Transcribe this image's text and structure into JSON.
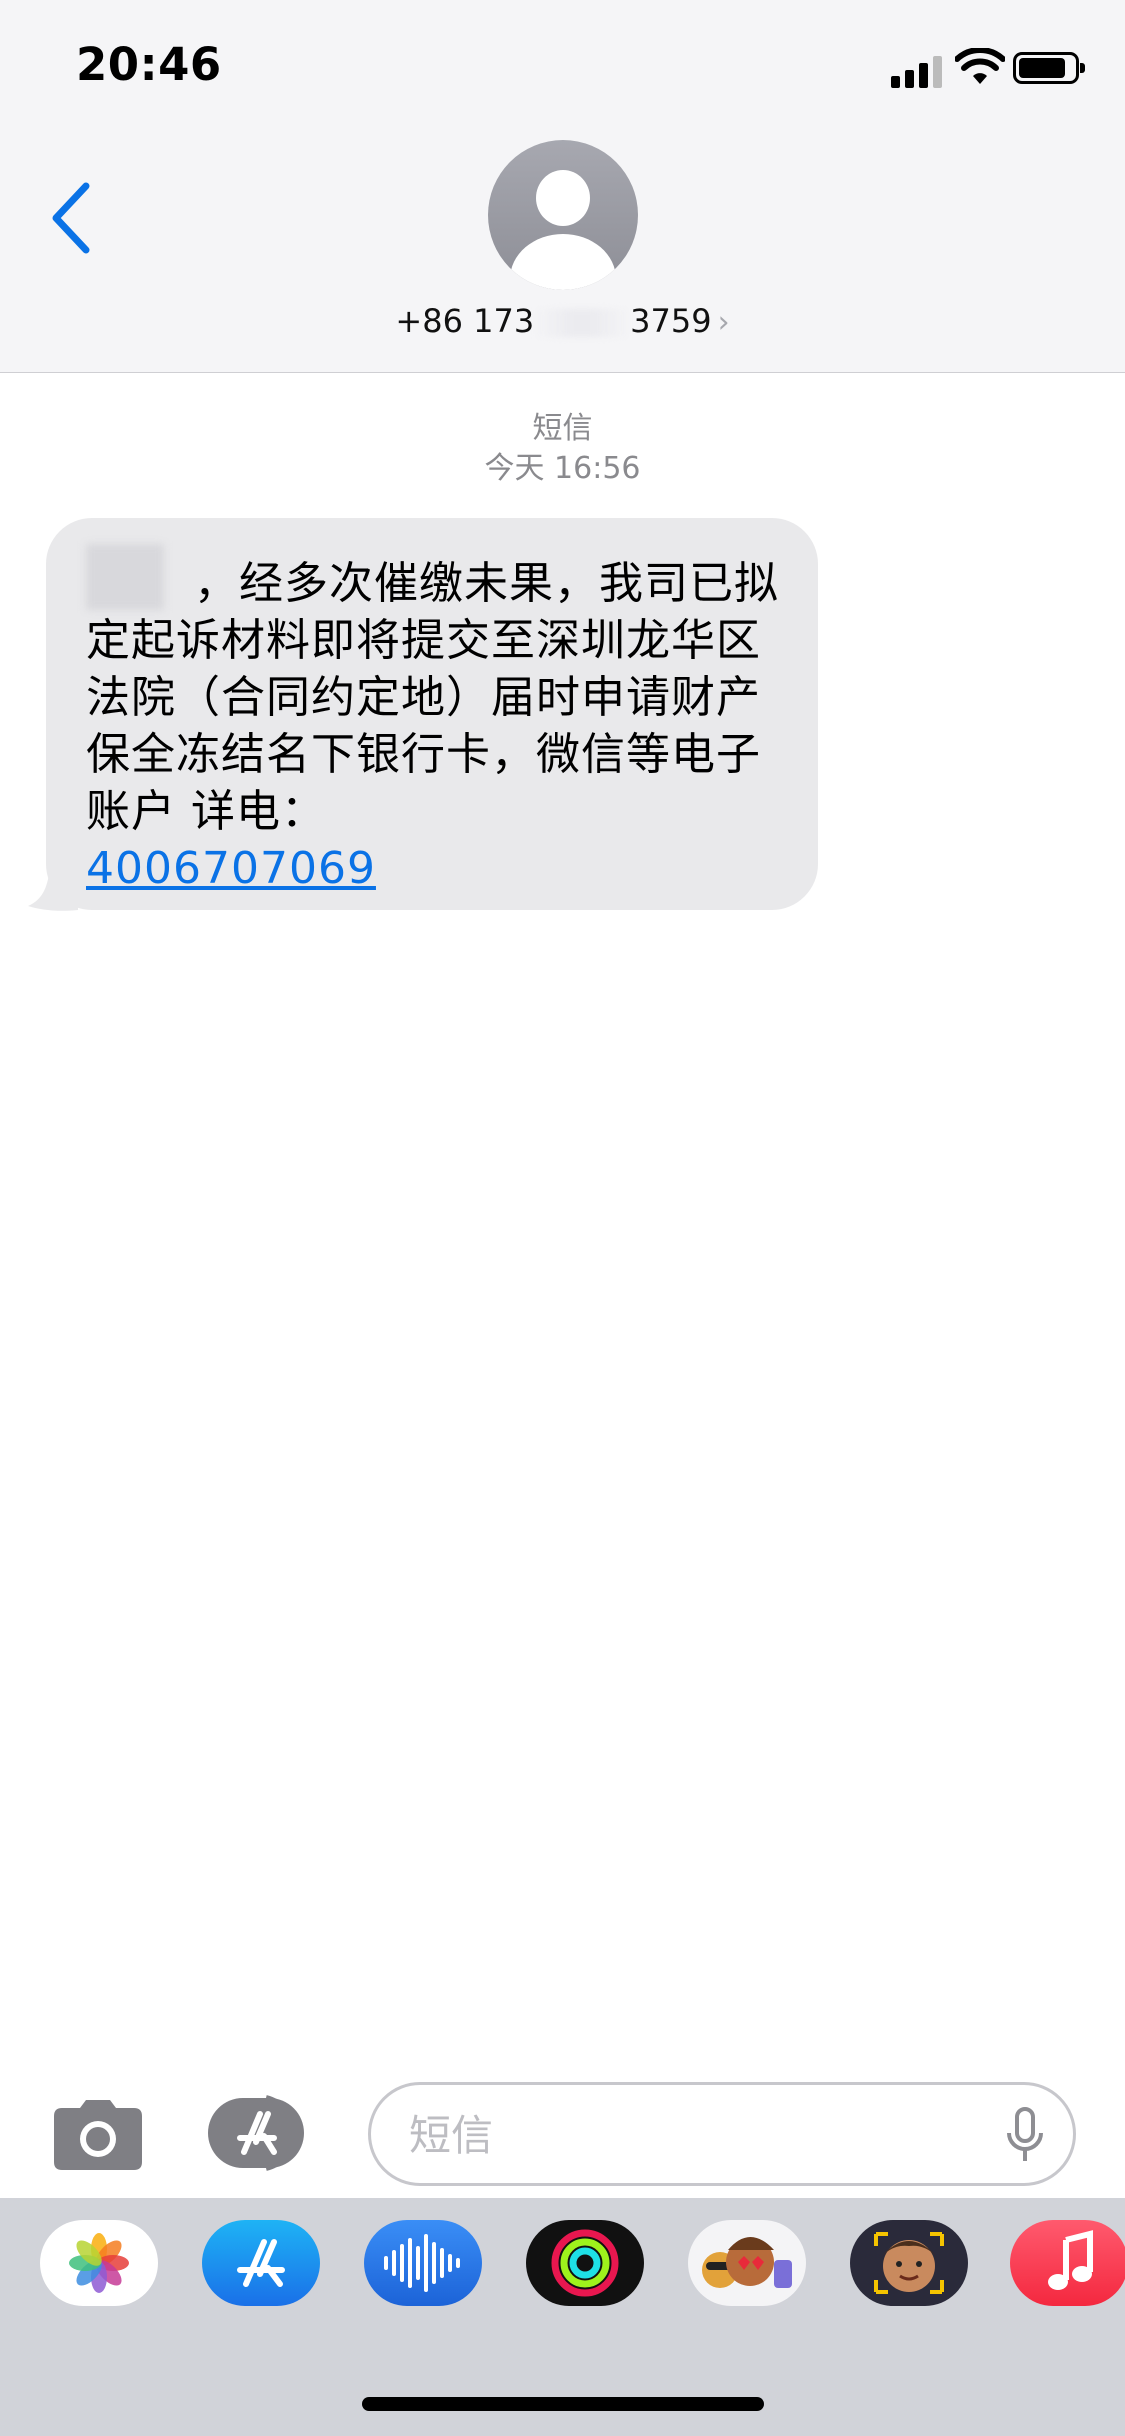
{
  "status_bar": {
    "time": "20:46"
  },
  "header": {
    "phone_prefix": "+86 173",
    "phone_suffix": "3759"
  },
  "conversation": {
    "service_label": "短信",
    "timestamp": "今天 16:56",
    "message": {
      "text": "，经多次催缴未果，我司已拟定起诉材料即将提交至深圳龙华区法院（合同约定地）届时申请财产保全冻结名下银行卡，微信等电子账户 详电：",
      "phone_link": "4006707069"
    }
  },
  "input_bar": {
    "placeholder": "短信"
  },
  "app_drawer": {
    "apps": [
      "photos-icon",
      "app-store-icon",
      "audio-messages-icon",
      "activity-icon",
      "animoji-stickers-icon",
      "memoji-icon",
      "music-icon"
    ]
  },
  "colors": {
    "link": "#0a72e6",
    "back": "#0a72e6",
    "bubble": "#e9e9eb",
    "header_bg": "#f5f5f7"
  }
}
